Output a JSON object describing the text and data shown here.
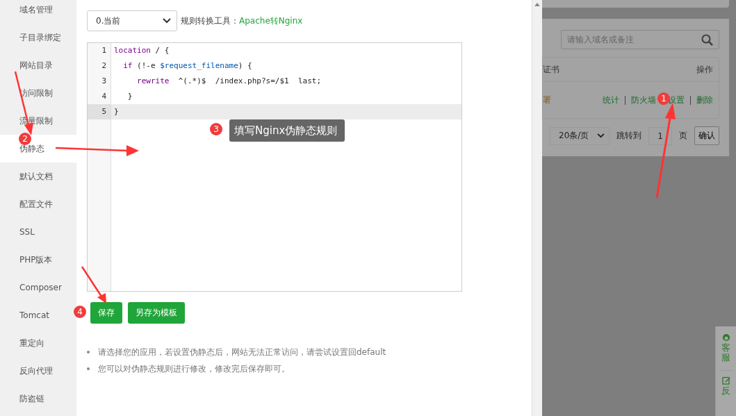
{
  "sidebar": {
    "items": [
      {
        "label": "域名管理",
        "selected": false
      },
      {
        "label": "子目录绑定",
        "selected": false
      },
      {
        "label": "网站目录",
        "selected": false
      },
      {
        "label": "访问限制",
        "selected": false
      },
      {
        "label": "流量限制",
        "selected": false
      },
      {
        "label": "伪静态",
        "selected": true
      },
      {
        "label": "默认文档",
        "selected": false
      },
      {
        "label": "配置文件",
        "selected": false
      },
      {
        "label": "SSL",
        "selected": false
      },
      {
        "label": "PHP版本",
        "selected": false
      },
      {
        "label": "Composer",
        "selected": false
      },
      {
        "label": "Tomcat",
        "selected": false
      },
      {
        "label": "重定向",
        "selected": false
      },
      {
        "label": "反向代理",
        "selected": false
      },
      {
        "label": "防盗链",
        "selected": false
      }
    ]
  },
  "rewrite": {
    "template_select": "0.当前",
    "tool_label": "规则转换工具：",
    "tool_link": "Apache转Nginx",
    "editor": {
      "lines": [
        {
          "number": "1",
          "active": false,
          "tokens": [
            {
              "text": "location",
              "kind": "keyword"
            },
            {
              "text": " / {",
              "kind": "plain"
            }
          ]
        },
        {
          "number": "2",
          "active": false,
          "tokens": [
            {
              "text": "  if",
              "kind": "keyword"
            },
            {
              "text": " (!-e ",
              "kind": "plain"
            },
            {
              "text": "$request_filename",
              "kind": "variable"
            },
            {
              "text": ") {",
              "kind": "plain"
            }
          ]
        },
        {
          "number": "3",
          "active": false,
          "tokens": [
            {
              "text": "     rewrite",
              "kind": "keyword"
            },
            {
              "text": "  ^(.*)$  /index.php?s=/$1  last;",
              "kind": "plain"
            }
          ]
        },
        {
          "number": "4",
          "active": false,
          "tokens": [
            {
              "text": "   }",
              "kind": "plain"
            }
          ]
        },
        {
          "number": "5",
          "active": true,
          "tokens": [
            {
              "text": "}",
              "kind": "plain"
            }
          ]
        }
      ]
    },
    "buttons": [
      "保存",
      "另存为模板"
    ],
    "notes": [
      "请选择您的应用，若设置伪静态后，网站无法正常访问，请尝试设置回default",
      "您可以对伪静态规则进行修改，修改完后保存即可。"
    ]
  },
  "background_page": {
    "search": {
      "placeholder": "请输入域名或备注"
    },
    "table": {
      "columns": [
        "证书",
        "操作"
      ],
      "rows": [
        {
          "status": "署",
          "actions": [
            "统计",
            "防火墙",
            "设置",
            "删除"
          ]
        }
      ]
    },
    "pager": {
      "page_size": "20条/页",
      "jump_label": "跳转到",
      "page": "1",
      "page_unit": "页",
      "confirm": "确认"
    },
    "float_buttons": [
      "客服",
      "反"
    ]
  },
  "annotations": [
    {
      "number": "1"
    },
    {
      "number": "2"
    },
    {
      "number": "3",
      "text": "填写Nginx伪静态规则"
    },
    {
      "number": "4"
    }
  ]
}
